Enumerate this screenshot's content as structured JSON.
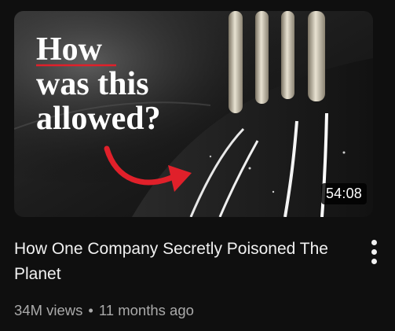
{
  "video": {
    "thumbnail": {
      "overlay_lines": [
        "How",
        "was this",
        "allowed?"
      ],
      "accent_color": "#e0202a",
      "icon": "red-arrow-icon"
    },
    "duration": "54:08",
    "title": "How One Company Secretly Poisoned The Planet",
    "views": "34M views",
    "separator": "•",
    "age": "11 months ago",
    "menu_icon": "more-vert-icon"
  },
  "colors": {
    "background": "#0f0f0f",
    "title": "#f1f1f1",
    "meta": "#aaaaaa"
  }
}
